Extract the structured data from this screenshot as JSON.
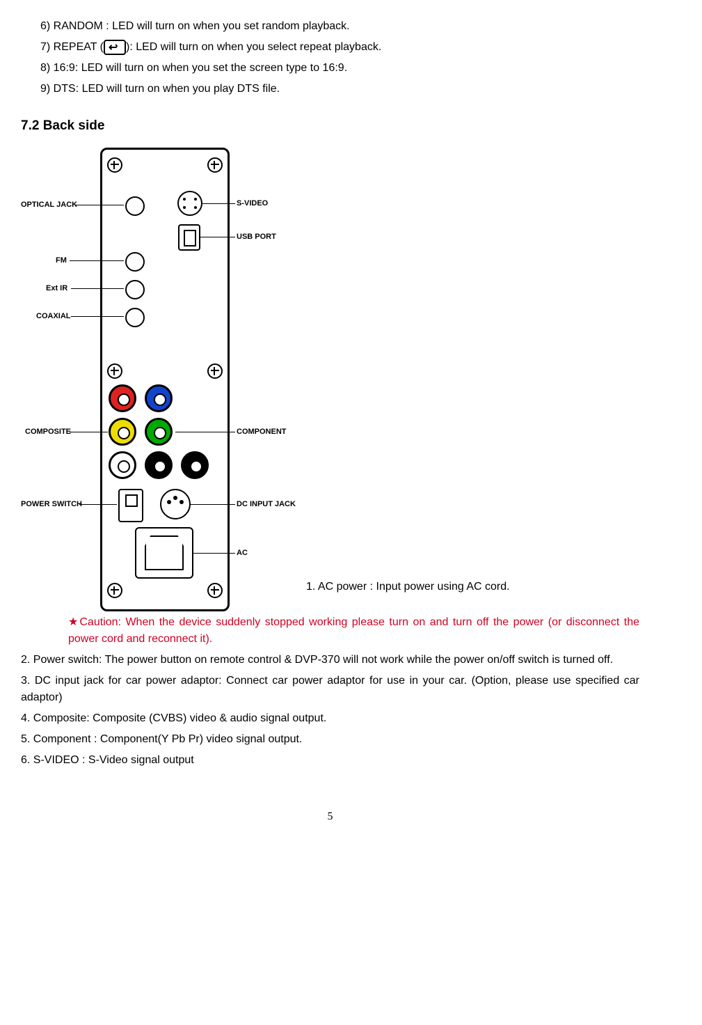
{
  "items": {
    "i6": "6) RANDOM : LED will turn on when you set random playback.",
    "i7a": "7) REPEAT (",
    "i7b": "): LED will turn on when you select repeat playback.",
    "i8": "8) 16:9: LED will turn on when you set the screen type to 16:9.",
    "i9": "9) DTS: LED will turn on when you play DTS file."
  },
  "section": "7.2   Back side",
  "diagram_labels": {
    "optical": "OPTICAL JACK",
    "svideo": "S-VIDEO",
    "usb": "USB PORT",
    "fm": "FM",
    "extir": "Ext IR",
    "coaxial": "COAXIAL",
    "component": "COMPONENT",
    "composite": "COMPOSITE",
    "powerswitch": "POWER SWITCH",
    "dcjack": "DC INPUT JACK",
    "ac": "AC"
  },
  "para": {
    "p1": "1. AC power : Input power using AC cord.",
    "caution": "★Caution: When the device suddenly stopped working please turn on and turn off the power (or disconnect the power cord and reconnect it).",
    "p2": "2. Power switch: The power button on remote control & DVP-370 will not work while the power on/off switch is turned off.",
    "p3": "3. DC input jack for car power adaptor: Connect car power adaptor for use in your car. (Option, please use specified car adaptor)",
    "p4": "4. Composite: Composite (CVBS) video & audio signal output.",
    "p5": "5. Component : Component(Y Pb Pr) video signal output.",
    "p6": "6. S-VIDEO : S-Video signal output"
  },
  "page_number": "5"
}
